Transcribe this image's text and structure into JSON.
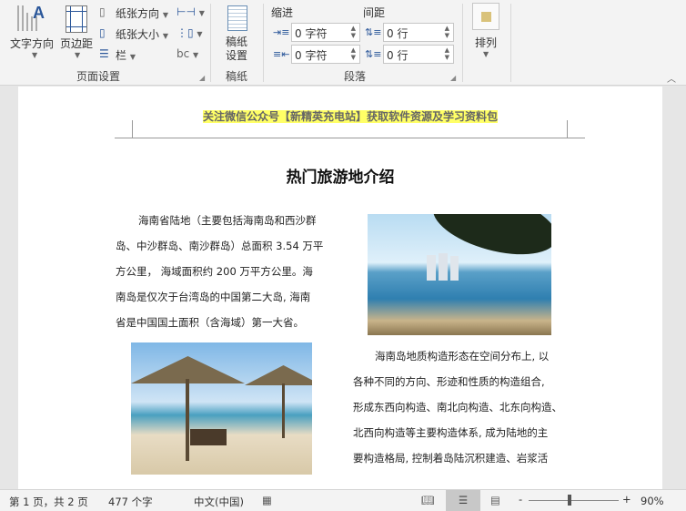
{
  "ribbon": {
    "text_direction": "文字方向",
    "margins": "页边距",
    "orientation": "纸张方向",
    "size": "纸张大小",
    "columns": "栏",
    "page_setup_group": "页面设置",
    "draft_paper": "稿纸\n设置",
    "draft_line1": "稿纸",
    "draft_line2": "设置",
    "draft_group": "稿纸",
    "indent_label": "缩进",
    "spacing_label": "间距",
    "indent_left": "0 字符",
    "indent_right": "0 字符",
    "spacing_before": "0 行",
    "spacing_after": "0 行",
    "paragraph_group": "段落",
    "arrange": "排列"
  },
  "document": {
    "header": "关注微信公众号【新精英充电站】获取软件资源及学习资料包",
    "title": "热门旅游地介绍",
    "para1": [
      "海南省陆地（主要包括海南岛和西沙群",
      "岛、中沙群岛、南沙群岛）总面积 3.54 万平",
      "方公里， 海域面积约 200 万平方公里。海",
      "南岛是仅次于台湾岛的中国第二大岛, 海南",
      "省是中国国土面积（含海域）第一大省。"
    ],
    "para2": [
      "海南岛地质构造形态在空间分布上, 以",
      "各种不同的方向、形迹和性质的构造组合,",
      "形成东西向构造、南北向构造、北东向构造、",
      "北西向构造等主要构造体系, 成为陆地的主",
      "要构造格局, 控制着岛陆沉积建造、岩浆活"
    ]
  },
  "status": {
    "page": "第 1 页，共 2 页",
    "words": "477 个字",
    "language": "中文(中国)",
    "zoom": "90%"
  },
  "colors": {
    "highlight": "#ffff66",
    "accent": "#2b579a"
  }
}
